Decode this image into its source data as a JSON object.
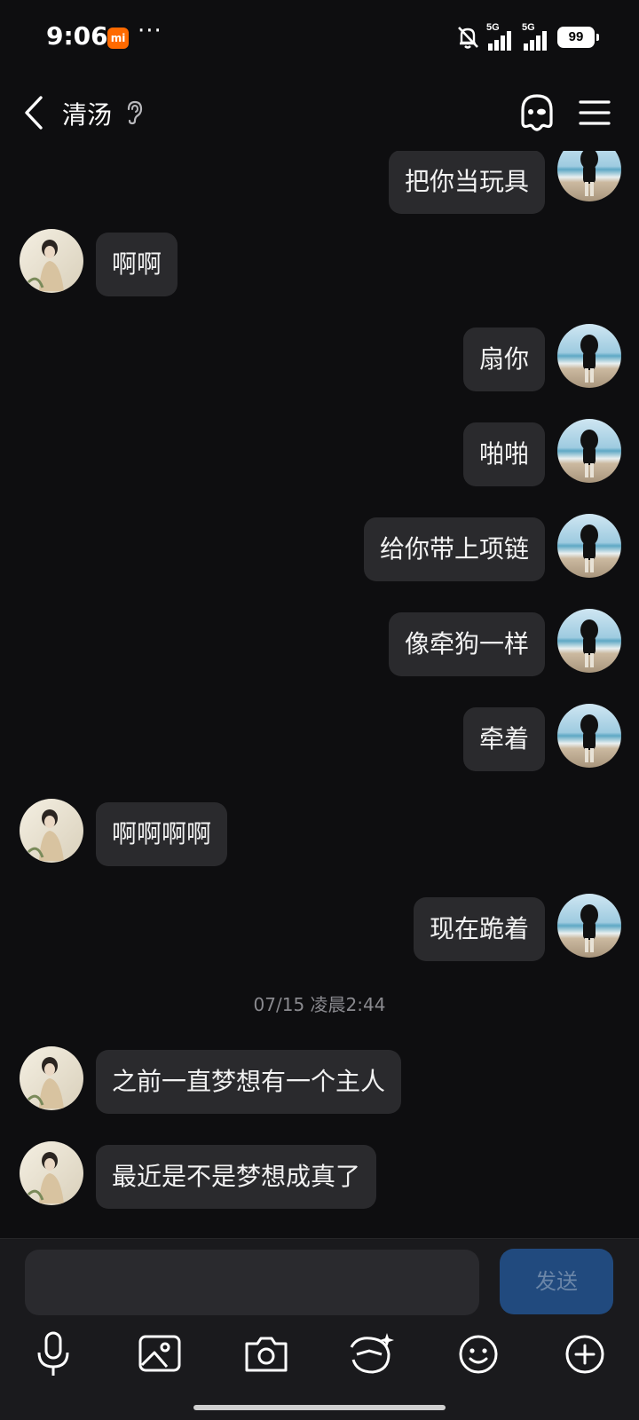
{
  "status_bar": {
    "time": "9:06",
    "brand_badge": "mi",
    "more": "···",
    "signal1_label": "5G",
    "signal2_label": "5G",
    "battery": "99"
  },
  "header": {
    "contact_name": "清汤",
    "icons": [
      "back-icon",
      "ear-icon",
      "ghost-icon",
      "menu-icon"
    ]
  },
  "messages": [
    {
      "side": "right",
      "text": "把你当玩具"
    },
    {
      "side": "left",
      "text": "啊啊"
    },
    {
      "side": "right",
      "text": "扇你"
    },
    {
      "side": "right",
      "text": "啪啪"
    },
    {
      "side": "right",
      "text": "给你带上项链"
    },
    {
      "side": "right",
      "text": "像牵狗一样"
    },
    {
      "side": "right",
      "text": "牵着"
    },
    {
      "side": "left",
      "text": "啊啊啊啊"
    },
    {
      "side": "right",
      "text": "现在跪着"
    },
    {
      "side": "left",
      "text": "之前一直梦想有一个主人"
    },
    {
      "side": "left",
      "text": "最近是不是梦想成真了"
    }
  ],
  "timestamp": "07/15 凌晨2:44",
  "input": {
    "placeholder": "",
    "value": "",
    "send_label": "发送"
  },
  "toolbar": [
    "microphone-icon",
    "image-icon",
    "camera-icon",
    "sticker-icon",
    "emoji-icon",
    "plus-icon"
  ],
  "colors": {
    "background": "#0e0e10",
    "bubble": "#2a2a2d",
    "send_button": "#214a7e",
    "accent_orange": "#ff6a00"
  }
}
